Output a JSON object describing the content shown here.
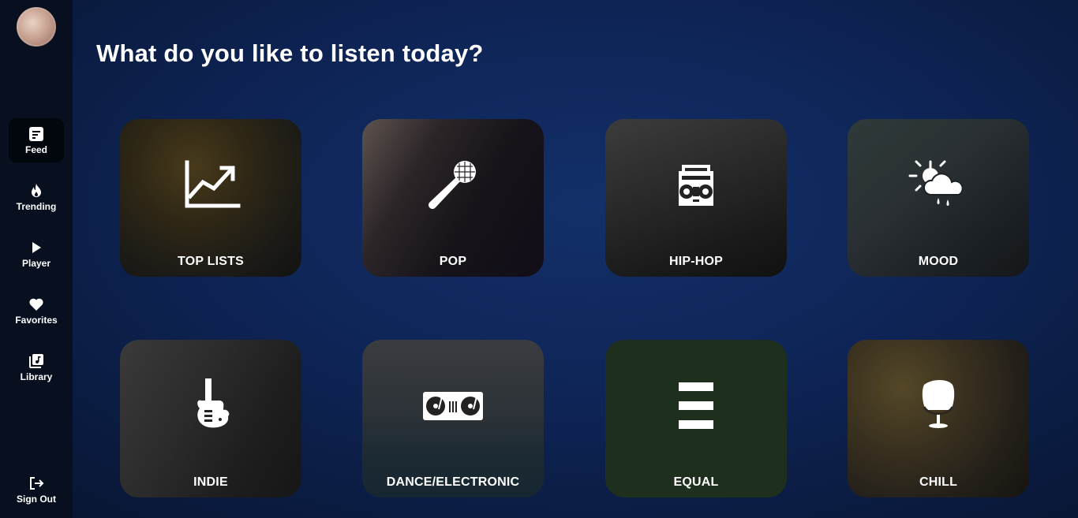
{
  "sidebar": {
    "avatar_alt": "user avatar",
    "items": [
      {
        "label": "Feed",
        "icon": "feed-icon",
        "active": true
      },
      {
        "label": "Trending",
        "icon": "flame-icon"
      },
      {
        "label": "Player",
        "icon": "play-icon"
      },
      {
        "label": "Favorites",
        "icon": "heart-icon"
      },
      {
        "label": "Library",
        "icon": "library-icon"
      }
    ],
    "signout": {
      "label": "Sign Out",
      "icon": "sign-out-icon"
    }
  },
  "main": {
    "title": "What do you like to listen today?",
    "categories": [
      {
        "label": "TOP LISTS",
        "icon": "trend-chart-icon"
      },
      {
        "label": "POP",
        "icon": "microphone-icon"
      },
      {
        "label": "HIP-HOP",
        "icon": "boombox-icon"
      },
      {
        "label": "MOOD",
        "icon": "weather-icon"
      },
      {
        "label": "INDIE",
        "icon": "electric-guitar-icon"
      },
      {
        "label": "DANCE/ELECTRONIC",
        "icon": "turntable-icon"
      },
      {
        "label": "EQUAL",
        "icon": "equal-bars-icon"
      },
      {
        "label": "CHILL",
        "icon": "egg-chair-icon"
      }
    ]
  },
  "colors": {
    "background": "#0e2455",
    "sidebar": "#080f1f",
    "equal_card": "#1e2f1e"
  }
}
